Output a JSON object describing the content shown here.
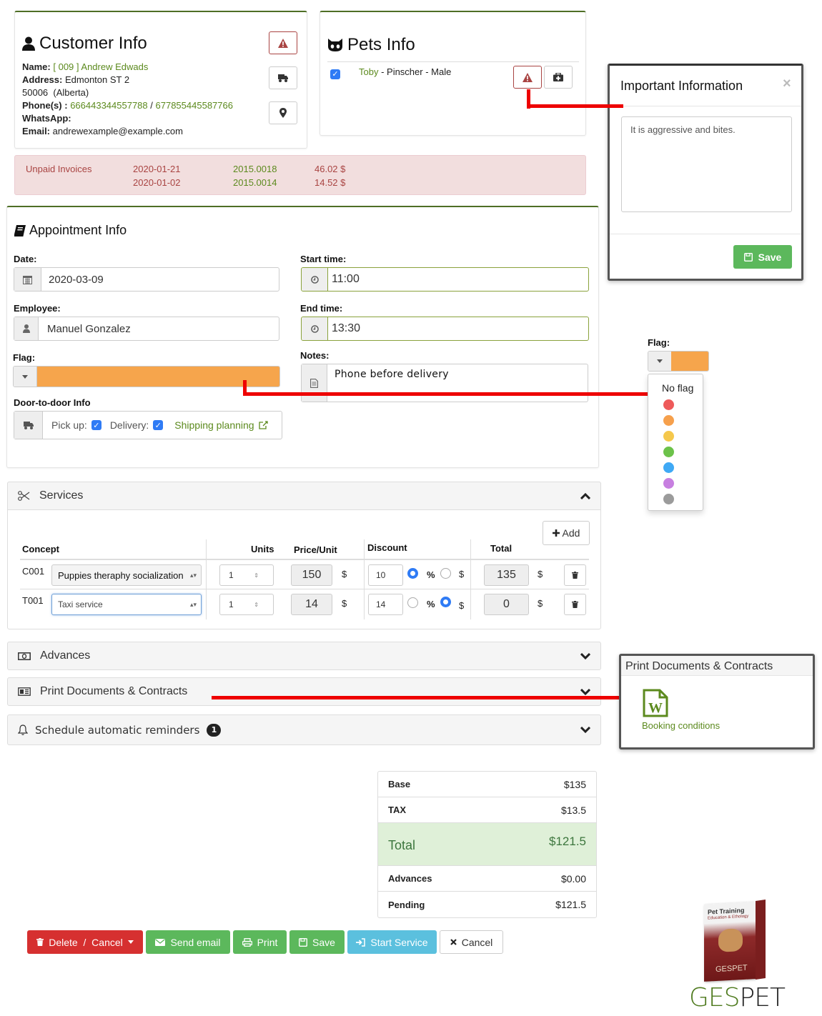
{
  "customer": {
    "title": "Customer Info",
    "name_label": "Name:",
    "name_value": "[ 009 ] Andrew Edwads",
    "address_label": "Address:",
    "address_value": "Edmonton ST 2",
    "address_line2": "50006  (Alberta)",
    "phones_label": "Phone(s) :",
    "phone1": "666443344557788",
    "phone_sep": "/",
    "phone2": "677855445587766",
    "whatsapp_label": "WhatsApp:",
    "whatsapp_value": "",
    "email_label": "Email:",
    "email_value": "andrewexample@example.com",
    "icons": [
      "warning-icon",
      "truck-icon",
      "map-marker-icon"
    ]
  },
  "pets": {
    "title": "Pets Info",
    "items": [
      {
        "checked": true,
        "name": "Toby",
        "details": " - Pinscher - Male"
      }
    ]
  },
  "important_info_modal": {
    "title": "Important Information",
    "close": "×",
    "text": "It is aggressive and bites.",
    "save_label": "Save"
  },
  "unpaid_invoices": {
    "label": "Unpaid Invoices",
    "rows": [
      {
        "date": "2020-01-21",
        "number": "2015.0018",
        "amount": "46.02 $"
      },
      {
        "date": "2020-01-02",
        "number": "2015.0014",
        "amount": "14.52 $"
      }
    ]
  },
  "appointment": {
    "title": "Appointment Info",
    "date_label": "Date:",
    "date_value": "2020-03-09",
    "employee_label": "Employee:",
    "employee_value": "Manuel Gonzalez",
    "flag_label": "Flag:",
    "flag_color": "#f6a54c",
    "start_label": "Start time:",
    "start_value": "11:00",
    "end_label": "End time:",
    "end_value": "13:30",
    "notes_label": "Notes:",
    "notes_value": "Phone before delivery",
    "door_label": "Door-to-door Info",
    "pickup_label": "Pick up:",
    "pickup_checked": true,
    "delivery_label": "Delivery:",
    "delivery_checked": true,
    "shipping_link": "Shipping planning"
  },
  "flag_dropdown": {
    "label": "Flag:",
    "selected_color": "#f6a54c",
    "no_flag": "No flag",
    "colors": [
      "#ee5a5a",
      "#f6a04c",
      "#f5c84c",
      "#6cc24a",
      "#3fa9f5",
      "#c77fe0",
      "#9b9b9b"
    ]
  },
  "services": {
    "title": "Services",
    "add_label": "Add",
    "headers": {
      "concept": "Concept",
      "units": "Units",
      "price": "Price/Unit",
      "discount": "Discount",
      "total": "Total"
    },
    "currency": "$",
    "percent": "%",
    "rows": [
      {
        "code": "C001",
        "concept": "Puppies theraphy socialization",
        "units": "1",
        "price": "150",
        "discount": "10",
        "discount_type": "%",
        "total": "135"
      },
      {
        "code": "T001",
        "concept": "Taxi service",
        "units": "1",
        "price": "14",
        "discount": "14",
        "discount_type": "$",
        "total": "0"
      }
    ]
  },
  "sections": {
    "advances": "Advances",
    "print_docs": "Print Documents & Contracts",
    "reminders": "Schedule automatic reminders",
    "reminders_badge": "1"
  },
  "print_popup": {
    "title": "Print Documents & Contracts",
    "doc_label": "Booking conditions"
  },
  "summary": {
    "rows": [
      {
        "label": "Base",
        "value": "$135"
      },
      {
        "label": "TAX",
        "value": "$13.5"
      },
      {
        "label": "Total",
        "value": "$121.5"
      },
      {
        "label": "Advances",
        "value": "$0.00"
      },
      {
        "label": "Pending",
        "value": "$121.5"
      }
    ]
  },
  "actions": {
    "delete_cancel": "Delete  /  Cancel",
    "send_email": "Send email",
    "print": "Print",
    "save": "Save",
    "start_service": "Start Service",
    "cancel": "Cancel"
  },
  "branding": {
    "box_title": "Pet Training",
    "box_subtitle": "Education & Ethology",
    "logo_part1": "GES",
    "logo_part2": "PET"
  }
}
